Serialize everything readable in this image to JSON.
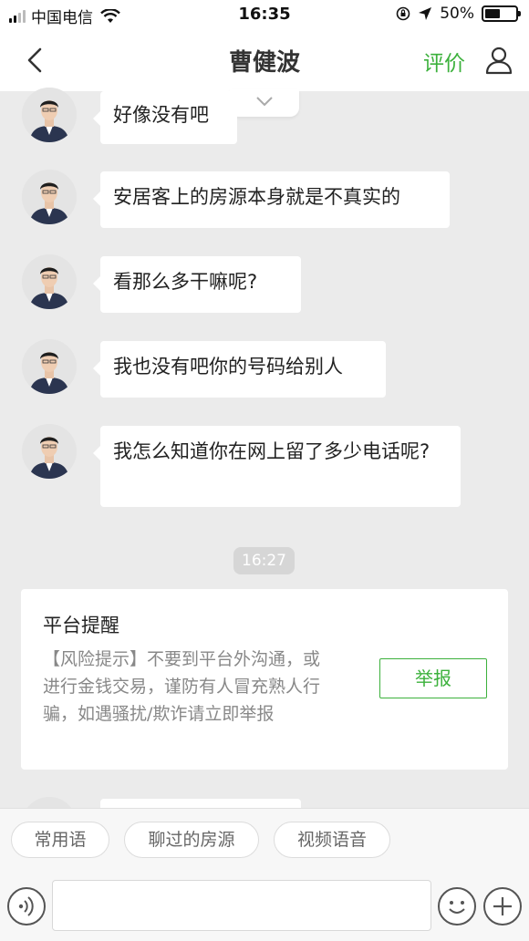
{
  "status_bar": {
    "carrier": "中国电信",
    "time": "16:35",
    "battery_text": "50%",
    "battery_level": 0.5
  },
  "nav": {
    "title": "曹健波",
    "rate_label": "评价"
  },
  "messages": [
    {
      "text": "好像没有吧"
    },
    {
      "text": "安居客上的房源本身就是不真实的"
    },
    {
      "text": "看那么多干嘛呢?"
    },
    {
      "text": "我也没有吧你的号码给别人"
    },
    {
      "text": "我怎么知道你在网上留了多少电话呢?"
    }
  ],
  "timestamp": "16:27",
  "notice": {
    "title": "平台提醒",
    "body": "【风险提示】不要到平台外沟通，或进行金钱交易，谨防有人冒充熟人行骗，如遇骚扰/欺诈请立即举报",
    "report_label": "举报"
  },
  "quick_replies": [
    "常用语",
    "聊过的房源",
    "视频语音"
  ],
  "input": {
    "placeholder": "",
    "value": ""
  },
  "colors": {
    "accent": "#3cb13c",
    "chat_bg": "#ebebeb"
  }
}
